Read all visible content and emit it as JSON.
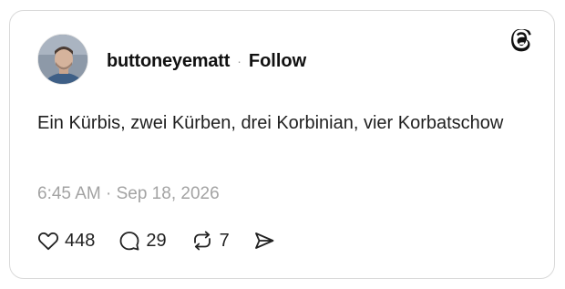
{
  "post": {
    "author": {
      "username": "buttoneyematt",
      "separator": "·",
      "follow_label": "Follow",
      "avatar_icon": "avatar-photo"
    },
    "text": "Ein Kürbis, zwei Kürben, drei Korbinian, vier Korbatschow",
    "timestamp": "6:45 AM · Sep 18, 2026",
    "brand_icon": "threads-logo-icon"
  },
  "actions": {
    "likes": {
      "icon": "heart-icon",
      "count": "448"
    },
    "replies": {
      "icon": "comment-icon",
      "count": "29"
    },
    "reposts": {
      "icon": "repost-icon",
      "count": "7"
    },
    "share": {
      "icon": "send-icon"
    }
  },
  "colors": {
    "border": "#d9d9d9",
    "muted_text": "#a3a3a3",
    "primary_text": "#111111"
  }
}
